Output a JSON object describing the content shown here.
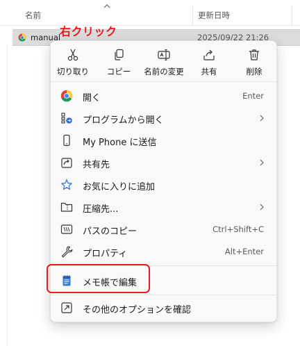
{
  "explorer": {
    "columns": {
      "name": "名前",
      "modified": "更新日時"
    },
    "file": {
      "name": "manual",
      "modified": "2025/09/22 21:26",
      "icon": "chrome-icon"
    },
    "annotation_label": "右クリック",
    "annotation_color": "#e8191f"
  },
  "menu": {
    "quick_actions": [
      {
        "label": "切り取り",
        "icon": "cut-icon"
      },
      {
        "label": "コピー",
        "icon": "copy-icon"
      },
      {
        "label": "名前の変更",
        "icon": "rename-icon"
      },
      {
        "label": "共有",
        "icon": "share-icon"
      },
      {
        "label": "削除",
        "icon": "delete-icon"
      }
    ],
    "items": [
      {
        "label": "開く",
        "shortcut": "Enter",
        "icon": "chrome-icon"
      },
      {
        "label": "プログラムから開く",
        "icon": "open-with-icon",
        "submenu": true
      },
      {
        "label": "My Phone に送信",
        "icon": "phone-icon"
      },
      {
        "label": "共有先",
        "icon": "share-to-icon",
        "submenu": true
      },
      {
        "label": "お気に入りに追加",
        "icon": "star-icon"
      },
      {
        "label": "圧縮先...",
        "icon": "compress-folder-icon",
        "submenu": true
      },
      {
        "label": "パスのコピー",
        "shortcut": "Ctrl+Shift+C",
        "icon": "copy-path-icon"
      },
      {
        "label": "プロパティ",
        "shortcut": "Alt+Enter",
        "icon": "wrench-icon"
      },
      {
        "label": "メモ帳で編集",
        "icon": "notepad-icon"
      },
      {
        "label": "その他のオプションを確認",
        "icon": "more-options-icon"
      }
    ]
  }
}
